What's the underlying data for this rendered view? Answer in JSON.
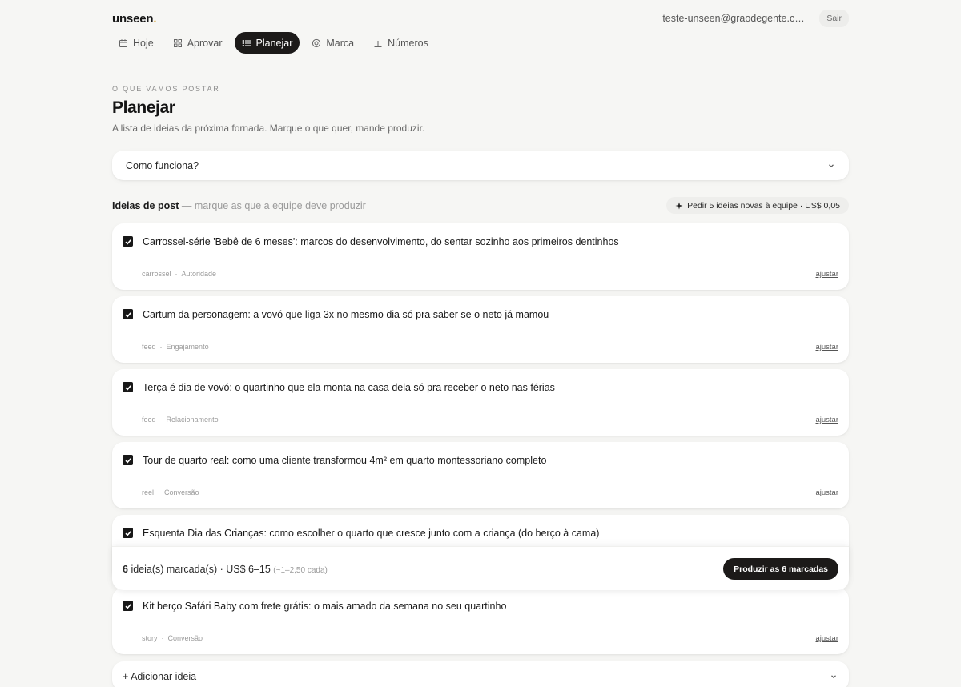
{
  "app": {
    "logo_text": "unseen",
    "logo_dot": ".",
    "accent_color": "#d8a63a"
  },
  "account": {
    "email": "teste-unseen@graodegente.com.br",
    "logout_label": "Sair"
  },
  "nav": [
    {
      "label": "Hoje",
      "icon": "calendar-icon",
      "active": false
    },
    {
      "label": "Aprovar",
      "icon": "grid-icon",
      "active": false
    },
    {
      "label": "Planejar",
      "icon": "list-icon",
      "active": true
    },
    {
      "label": "Marca",
      "icon": "target-icon",
      "active": false
    },
    {
      "label": "Números",
      "icon": "bar-chart-icon",
      "active": false
    }
  ],
  "page": {
    "eyebrow": "O que vamos postar",
    "title": "Planejar",
    "subtitle": "A lista de ideias da próxima fornada. Marque o que quer, mande produzir."
  },
  "how_it_works": {
    "label": "Como funciona?"
  },
  "ideas_section": {
    "title": "Ideias de post",
    "hint": "— marque as que a equipe deve produzir",
    "ask_label": "Pedir 5 ideias novas à equipe · US$ 0,05",
    "ask_icon": "sparkle-icon"
  },
  "ideas": [
    {
      "text": "Carrossel-série 'Bebê de 6 meses': marcos do desenvolvimento, do sentar sozinho aos primeiros dentinhos",
      "format": "carrossel",
      "goal": "Autoridade",
      "checked": true,
      "adjust_label": "ajustar"
    },
    {
      "text": "Cartum da personagem: a vovó que liga 3x no mesmo dia só pra saber se o neto já mamou",
      "format": "feed",
      "goal": "Engajamento",
      "checked": true,
      "adjust_label": "ajustar"
    },
    {
      "text": "Terça é dia de vovó: o quartinho que ela monta na casa dela só pra receber o neto nas férias",
      "format": "feed",
      "goal": "Relacionamento",
      "checked": true,
      "adjust_label": "ajustar"
    },
    {
      "text": "Tour de quarto real: como uma cliente transformou 4m² em quarto montessoriano completo",
      "format": "reel",
      "goal": "Conversão",
      "checked": true,
      "adjust_label": "ajustar"
    },
    {
      "text": "Esquenta Dia das Crianças: como escolher o quarto que cresce junto com a criança (do berço à cama)",
      "format": "",
      "goal": "",
      "checked": true,
      "adjust_label": ""
    },
    {
      "text": "Kit berço Safári Baby com frete grátis: o mais amado da semana no seu quartinho",
      "format": "story",
      "goal": "Conversão",
      "checked": true,
      "adjust_label": "ajustar"
    }
  ],
  "summary": {
    "count": "6",
    "count_label": "ideia(s) marcada(s) · US$ 6–15",
    "per_item": "(~1–2,50 cada)",
    "produce_label": "Produzir as 6 marcadas"
  },
  "add_idea": {
    "label": "+ Adicionar ideia"
  },
  "colors": {
    "background": "#f6f6f4",
    "dark": "#1c1a19",
    "card": "#ffffff"
  }
}
